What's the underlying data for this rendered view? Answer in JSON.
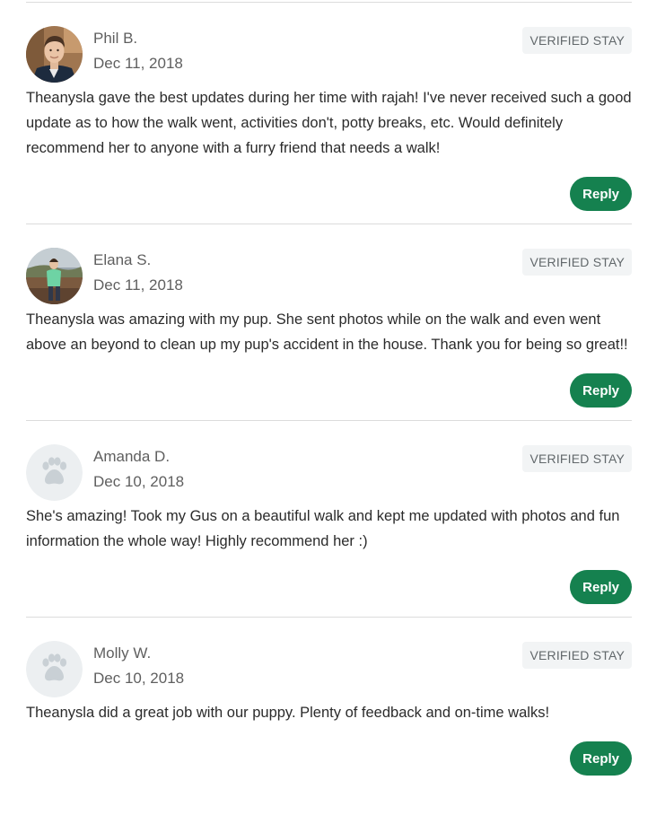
{
  "reviews": [
    {
      "name": "Phil B.",
      "date": "Dec 11, 2018",
      "badge": "VERIFIED STAY",
      "text": "Theanysla gave the best updates during her time with rajah! I've never received such a good update as to how the walk went, activities don't, potty breaks, etc. Would definitely recommend her to anyone with a furry friend that needs a walk!",
      "reply_label": "Reply",
      "avatar": "photo-man"
    },
    {
      "name": "Elana S.",
      "date": "Dec 11, 2018",
      "badge": "VERIFIED STAY",
      "text": "Theanysla was amazing with my pup. She sent photos while on the walk and even went above an beyond to clean up my pup's accident in the house. Thank you for being so great!!",
      "reply_label": "Reply",
      "avatar": "photo-hiker"
    },
    {
      "name": "Amanda D.",
      "date": "Dec 10, 2018",
      "badge": "VERIFIED STAY",
      "text": "She's amazing! Took my Gus on a beautiful walk and kept me updated with photos and fun information the whole way! Highly recommend her :)",
      "reply_label": "Reply",
      "avatar": "paw-icon"
    },
    {
      "name": "Molly W.",
      "date": "Dec 10, 2018",
      "badge": "VERIFIED STAY",
      "text": "Theanysla did a great job with our puppy. Plenty of feedback and on-time walks!",
      "reply_label": "Reply",
      "avatar": "paw-icon"
    }
  ],
  "colors": {
    "accent": "#15814f",
    "badge_bg": "#f2f4f5",
    "divider": "#dcdcdc",
    "paw": "#c9d0d5",
    "paw_bg": "#eceff1"
  }
}
